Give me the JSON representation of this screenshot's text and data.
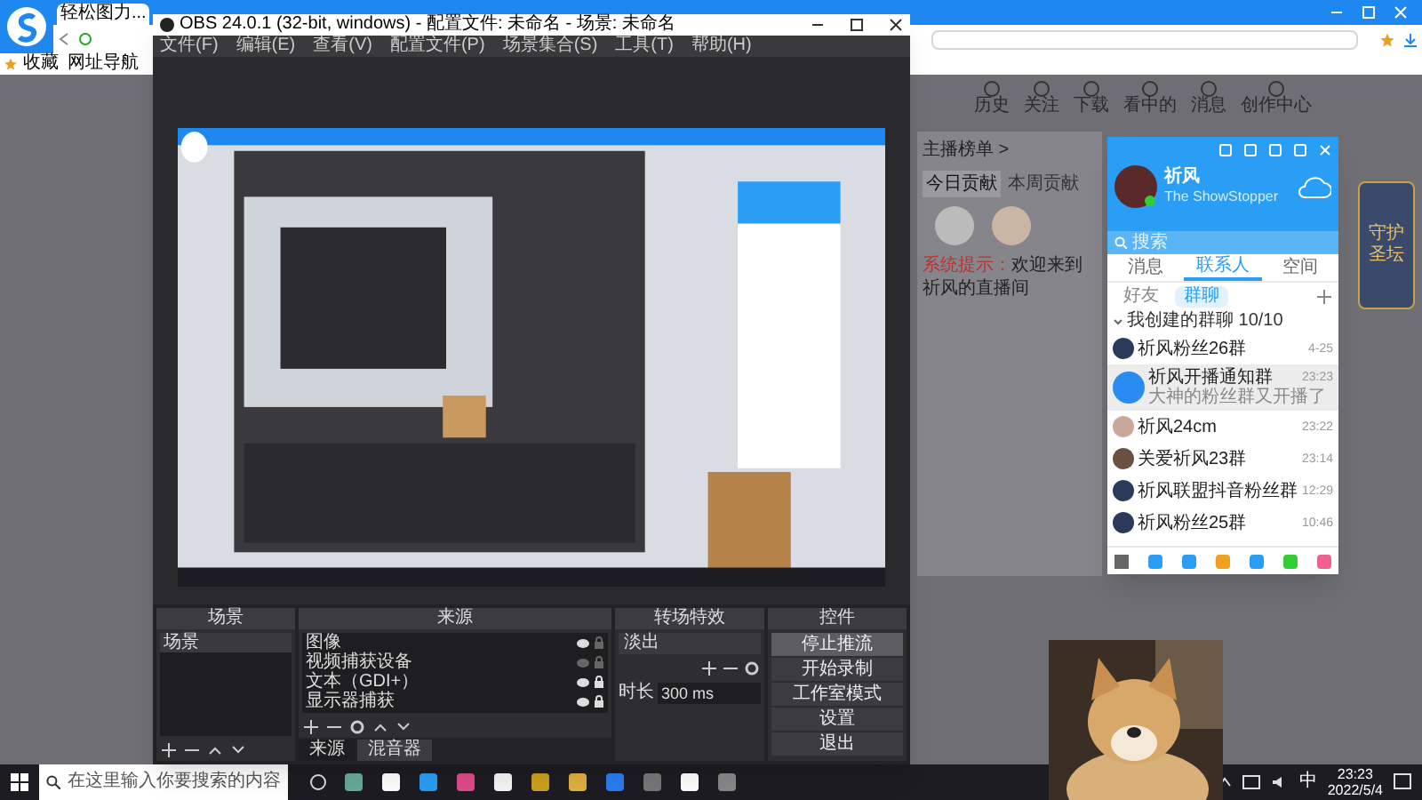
{
  "browser": {
    "tab": "轻松图力...",
    "bookmarks": [
      "收藏",
      "网址导航"
    ]
  },
  "page": {
    "nav": [
      "历史",
      "关注",
      "下载",
      "看中的",
      "消息",
      "创作中心"
    ],
    "rank_title": "主播榜单 >",
    "rank_tabs": [
      {
        "label": "今日贡献",
        "selected": true
      },
      {
        "label": "本周贡献",
        "selected": false
      }
    ],
    "notice_label": "系统提示：",
    "notice": "欢迎来到祈风的直播间",
    "badge": "守护圣坛"
  },
  "obs": {
    "title": "OBS 24.0.1 (32-bit, windows) - 配置文件: 未命名 - 场景: 未命名",
    "menu": [
      "文件(F)",
      "编辑(E)",
      "查看(V)",
      "配置文件(P)",
      "场景集合(S)",
      "工具(T)",
      "帮助(H)"
    ],
    "scenes": {
      "title": "场景",
      "items": [
        {
          "label": "场景",
          "selected": true
        }
      ]
    },
    "sources": {
      "title": "来源",
      "items": [
        {
          "label": "图像",
          "visible": true,
          "locked": false
        },
        {
          "label": "视频捕获设备",
          "visible": false,
          "locked": false
        },
        {
          "label": "文本（GDI+）",
          "visible": true,
          "locked": true
        },
        {
          "label": "显示器捕获",
          "visible": true,
          "locked": true
        }
      ]
    },
    "dock_tabs": [
      {
        "label": "来源",
        "selected": true
      },
      {
        "label": "混音器",
        "selected": false
      }
    ],
    "transitions": {
      "title": "转场特效",
      "selected": "淡出",
      "duration_label": "时长",
      "duration": "300 ms"
    },
    "controls": {
      "title": "控件",
      "buttons": [
        {
          "label": "停止推流",
          "active": true
        },
        {
          "label": "开始录制",
          "active": false
        },
        {
          "label": "工作室模式",
          "active": false
        },
        {
          "label": "设置",
          "active": false
        },
        {
          "label": "退出",
          "active": false
        }
      ]
    }
  },
  "qq": {
    "name": "祈风",
    "signature": "The ShowStopper",
    "search_placeholder": "搜索",
    "tabs": [
      {
        "label": "消息",
        "selected": false
      },
      {
        "label": "联系人",
        "selected": true
      },
      {
        "label": "空间",
        "selected": false
      }
    ],
    "subtabs": [
      {
        "label": "好友",
        "selected": false
      },
      {
        "label": "群聊",
        "selected": true
      }
    ],
    "group_header": "我创建的群聊 10/10",
    "groups": [
      {
        "name": "祈风粉丝26群",
        "time": "4-25",
        "selected": false
      },
      {
        "name": "祈风开播通知群",
        "time": "23:23",
        "preview": "大神的粉丝群又开播了",
        "selected": true
      },
      {
        "name": "祈风24cm",
        "time": "23:22",
        "selected": false
      },
      {
        "name": "关爱祈风23群",
        "time": "23:14",
        "selected": false
      },
      {
        "name": "祈风联盟抖音粉丝群",
        "time": "12:29",
        "selected": false
      },
      {
        "name": "祈风粉丝25群",
        "time": "10:46",
        "selected": false
      }
    ]
  },
  "taskbar": {
    "search_placeholder": "在这里输入你要搜索的内容",
    "ime": "中",
    "time": "23:23",
    "date": "2022/5/4"
  }
}
